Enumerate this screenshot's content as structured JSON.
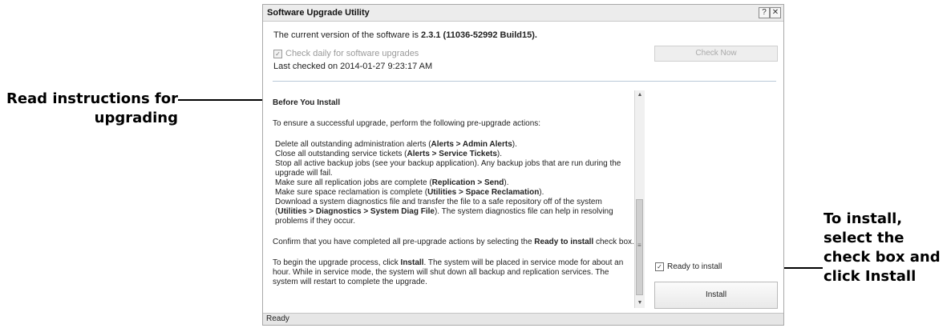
{
  "callouts": {
    "left_line1": "Read instructions for",
    "left_line2": "upgrading",
    "right_line1": "To install,",
    "right_line2": "select the",
    "right_line3": "check box and",
    "right_line4": "click Install"
  },
  "dialog": {
    "title": "Software Upgrade Utility",
    "help_icon": "?",
    "close_icon": "✕",
    "version_prefix": "The current version of the software is ",
    "version_value": "2.3.1 (11036-52992 Build15).",
    "check_daily_label": "Check daily for software upgrades",
    "last_checked": "Last checked on 2014-01-27 9:23:17 AM",
    "check_now_label": "Check Now",
    "ready_label": "Ready to install",
    "install_label": "Install",
    "status": "Ready"
  },
  "instructions": {
    "heading": "Before You Install",
    "intro": "To ensure a successful upgrade, perform the following pre-upgrade actions:",
    "a1_pre": "Delete all outstanding administration alerts (",
    "a1_bold": "Alerts > Admin Alerts",
    "a1_post": ").",
    "a2_pre": "Close all outstanding service tickets (",
    "a2_bold": "Alerts > Service Tickets",
    "a2_post": ").",
    "a3": "Stop all active backup jobs (see your backup application). Any backup jobs that are run during the upgrade will fail.",
    "a4_pre": "Make sure all replication jobs are complete (",
    "a4_bold": "Replication > Send",
    "a4_post": ").",
    "a5_pre": "Make sure space reclamation is complete (",
    "a5_bold": "Utilities > Space Reclamation",
    "a5_post": ").",
    "a6_pre": "Download a system diagnostics file and transfer the file to a safe repository off of the system (",
    "a6_bold": "Utilities > Diagnostics > System Diag File",
    "a6_post": "). The system diagnostics file can help in resolving problems if they occur.",
    "confirm_pre": "Confirm that you have completed all pre-upgrade actions by selecting the ",
    "confirm_bold": "Ready to install",
    "confirm_post": " check box.",
    "begin_pre": "To begin the upgrade process, click ",
    "begin_bold": "Install",
    "begin_post": ". The system will be placed in service mode for about an hour. While in service mode, the system will shut down all backup and replication services. The system will restart to complete the upgrade."
  },
  "icons": {
    "check_daily_checkbox": "checkbox-checked-disabled",
    "ready_checkbox": "checkbox-checked",
    "scroll_up": "arrow-up",
    "scroll_down": "arrow-down"
  },
  "colors": {
    "titlebar": "#ececec",
    "divider": "#b8c9d8"
  }
}
